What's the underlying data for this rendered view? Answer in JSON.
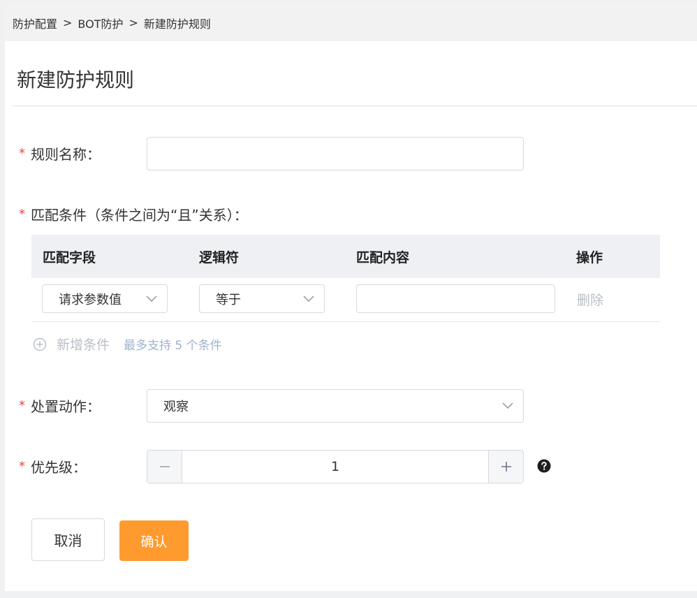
{
  "breadcrumb": {
    "items": [
      "防护配置",
      "BOT防护",
      "新建防护规则"
    ],
    "separator": ">"
  },
  "page": {
    "title": "新建防护规则"
  },
  "form": {
    "required_mark": "*",
    "rule_name": {
      "label": "规则名称：",
      "value": ""
    },
    "conditions": {
      "label": "匹配条件（条件之间为“且”关系）：",
      "columns": [
        "匹配字段",
        "逻辑符",
        "匹配内容",
        "操作"
      ],
      "rows": [
        {
          "field": "请求参数值",
          "operator": "等于",
          "content": "",
          "action": "删除"
        }
      ],
      "add_label": "新增条件",
      "add_hint": "最多支持 5 个条件"
    },
    "action": {
      "label": "处置动作：",
      "value": "观察"
    },
    "priority": {
      "label": "优先级：",
      "value": "1"
    }
  },
  "buttons": {
    "cancel": "取消",
    "confirm": "确认"
  },
  "icons": {
    "chevron": "chevron-down-icon",
    "add": "plus-circle-icon",
    "help": "question-circle-icon",
    "minus": "minus-icon",
    "plus": "plus-icon"
  },
  "colors": {
    "accent": "#ff9a2e",
    "required": "#e8473a",
    "muted_link": "#b9bec6",
    "hint": "#9fb3cc"
  }
}
